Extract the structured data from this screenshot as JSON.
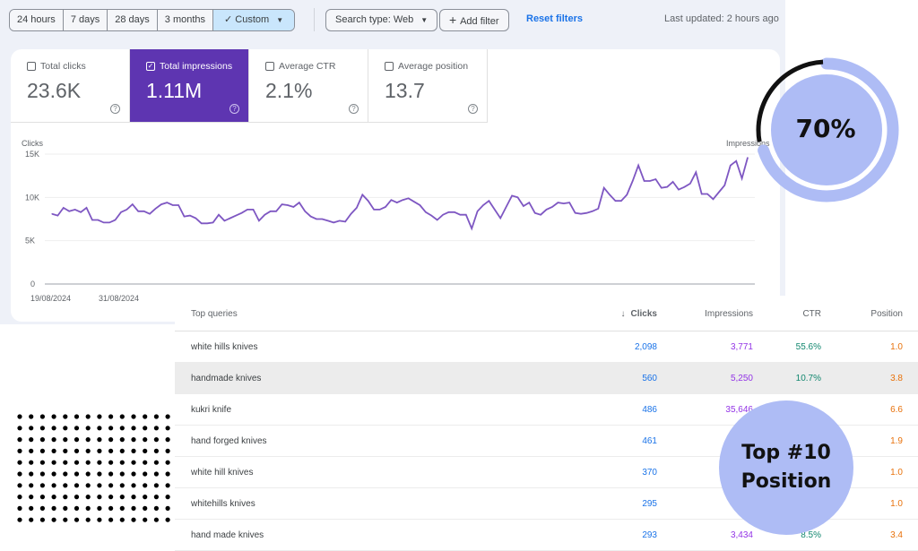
{
  "toolbar": {
    "ranges": [
      "24 hours",
      "7 days",
      "28 days",
      "3 months"
    ],
    "custom": "Custom",
    "search_type": "Search type: Web",
    "add_filter": "Add filter",
    "reset": "Reset filters",
    "updated": "Last updated: 2 hours ago"
  },
  "metrics": [
    {
      "label": "Total clicks",
      "value": "23.6K",
      "checked": false
    },
    {
      "label": "Total impressions",
      "value": "1.11M",
      "checked": true
    },
    {
      "label": "Average CTR",
      "value": "2.1%",
      "checked": false
    },
    {
      "label": "Average position",
      "value": "13.7",
      "checked": false
    }
  ],
  "colors": {
    "accent": "#5e35b1",
    "line": "#7e57c2",
    "badge": "#aebcf5"
  },
  "chart_data": {
    "type": "line",
    "ylabel_left": "Clicks",
    "ylabel_right": "Impressions",
    "ylim": [
      0,
      15000
    ],
    "yticks": [
      "0",
      "5K",
      "10K",
      "15K"
    ],
    "xticks": [
      "19/08/2024",
      "31/08/2024"
    ],
    "grid": true,
    "series": [
      {
        "values": [
          8100,
          7900,
          8800,
          8400,
          8600,
          8300,
          8800,
          7400,
          7400,
          7100,
          7100,
          7400,
          8300,
          8600,
          9200,
          8400,
          8400,
          8100,
          8700,
          9200,
          9400,
          9100,
          9100,
          7800,
          7900,
          7600,
          7000,
          7000,
          7100,
          8000,
          7300,
          7600,
          7900,
          8200,
          8600,
          8600,
          7300,
          8000,
          8400,
          8400,
          9200,
          9100,
          8900,
          9400,
          8400,
          7800,
          7500,
          7500,
          7300,
          7100,
          7300,
          7200,
          8100,
          8800,
          10300,
          9600,
          8600,
          8600,
          8900,
          9700,
          9400,
          9700,
          9900,
          9500,
          9100,
          8300,
          7900,
          7400,
          8000,
          8300,
          8300,
          8000,
          8000,
          6400,
          8400,
          9100,
          9600,
          8600,
          7600,
          8900,
          10200,
          10000,
          9000,
          9400,
          8200,
          8000,
          8600,
          8900,
          9400,
          9300,
          9400,
          8200,
          8100,
          8200,
          8400,
          8700,
          11100,
          10300,
          9600,
          9600,
          10300,
          11900,
          13700,
          11900,
          11900,
          12100,
          11100,
          11200,
          11800,
          10900,
          11200,
          11600,
          12900,
          10400,
          10400,
          9800,
          10600,
          11400,
          13700,
          14200,
          12200,
          14600
        ]
      }
    ]
  },
  "ring": {
    "percent": 70,
    "label": "70%"
  },
  "table": {
    "headers": {
      "query": "Top queries",
      "clicks": "Clicks",
      "impressions": "Impressions",
      "ctr": "CTR",
      "position": "Position"
    },
    "rows": [
      {
        "query": "white hills knives",
        "clicks": "2,098",
        "impressions": "3,771",
        "ctr": "55.6%",
        "position": "1.0"
      },
      {
        "query": "handmade knives",
        "clicks": "560",
        "impressions": "5,250",
        "ctr": "10.7%",
        "position": "3.8"
      },
      {
        "query": "kukri knife",
        "clicks": "486",
        "impressions": "35,646",
        "ctr": "",
        "position": "6.6"
      },
      {
        "query": "hand forged knives",
        "clicks": "461",
        "impressions": "",
        "ctr": "",
        "position": "1.9"
      },
      {
        "query": "white hill knives",
        "clicks": "370",
        "impressions": "",
        "ctr": "",
        "position": "1.0"
      },
      {
        "query": "whitehills knives",
        "clicks": "295",
        "impressions": "",
        "ctr": "",
        "position": "1.0"
      },
      {
        "query": "hand made knives",
        "clicks": "293",
        "impressions": "3,434",
        "ctr": "8.5%",
        "position": "3.4"
      }
    ]
  },
  "badge": {
    "line1": "Top #10",
    "line2": "Position"
  }
}
